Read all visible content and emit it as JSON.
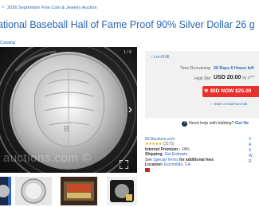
{
  "breadcrumb": {
    "home_icon": "home-icon",
    "text": "2026 September Fine Coin & Jewelry Auction"
  },
  "title": "ational Baseball Hall of Fame Proof 90% Silver Dollar 26 g",
  "category_link": "Catalog",
  "gallery": {
    "counter": "1 / 6",
    "watermark": "auctions.com ©",
    "next_icon": "chevron-right-icon",
    "expand_icon": "expand-icon"
  },
  "lot": {
    "label": "Lot #106",
    "arrow_icon": "chevron-left-icon"
  },
  "bid": {
    "time_label": "Time Remaining",
    "time_value": "26 Days 6 Hours left",
    "high_label": "High Bid",
    "high_value": "USD 20.00",
    "high_user": "by u***",
    "button_label": "BID NOW $25.00",
    "max_bid_label": "Enter a maximum bid"
  },
  "help": {
    "text": "Need help with bidding?",
    "link": "Get He"
  },
  "seller": {
    "name": "NCAuctions.com",
    "stars": "★★★★★",
    "count": "(3175)",
    "premium_label": "Internet Premium :",
    "premium_value": "14%",
    "shipping_label": "Shipping:",
    "shipping_value": "Get Estimate",
    "terms_prefix": "See",
    "terms_link": "Special Terms",
    "terms_suffix": "for additional fees",
    "location_label": "Location:",
    "location_value": "Escondido, CA"
  },
  "side_links": [
    "V",
    "A",
    "S",
    "W",
    "R"
  ]
}
